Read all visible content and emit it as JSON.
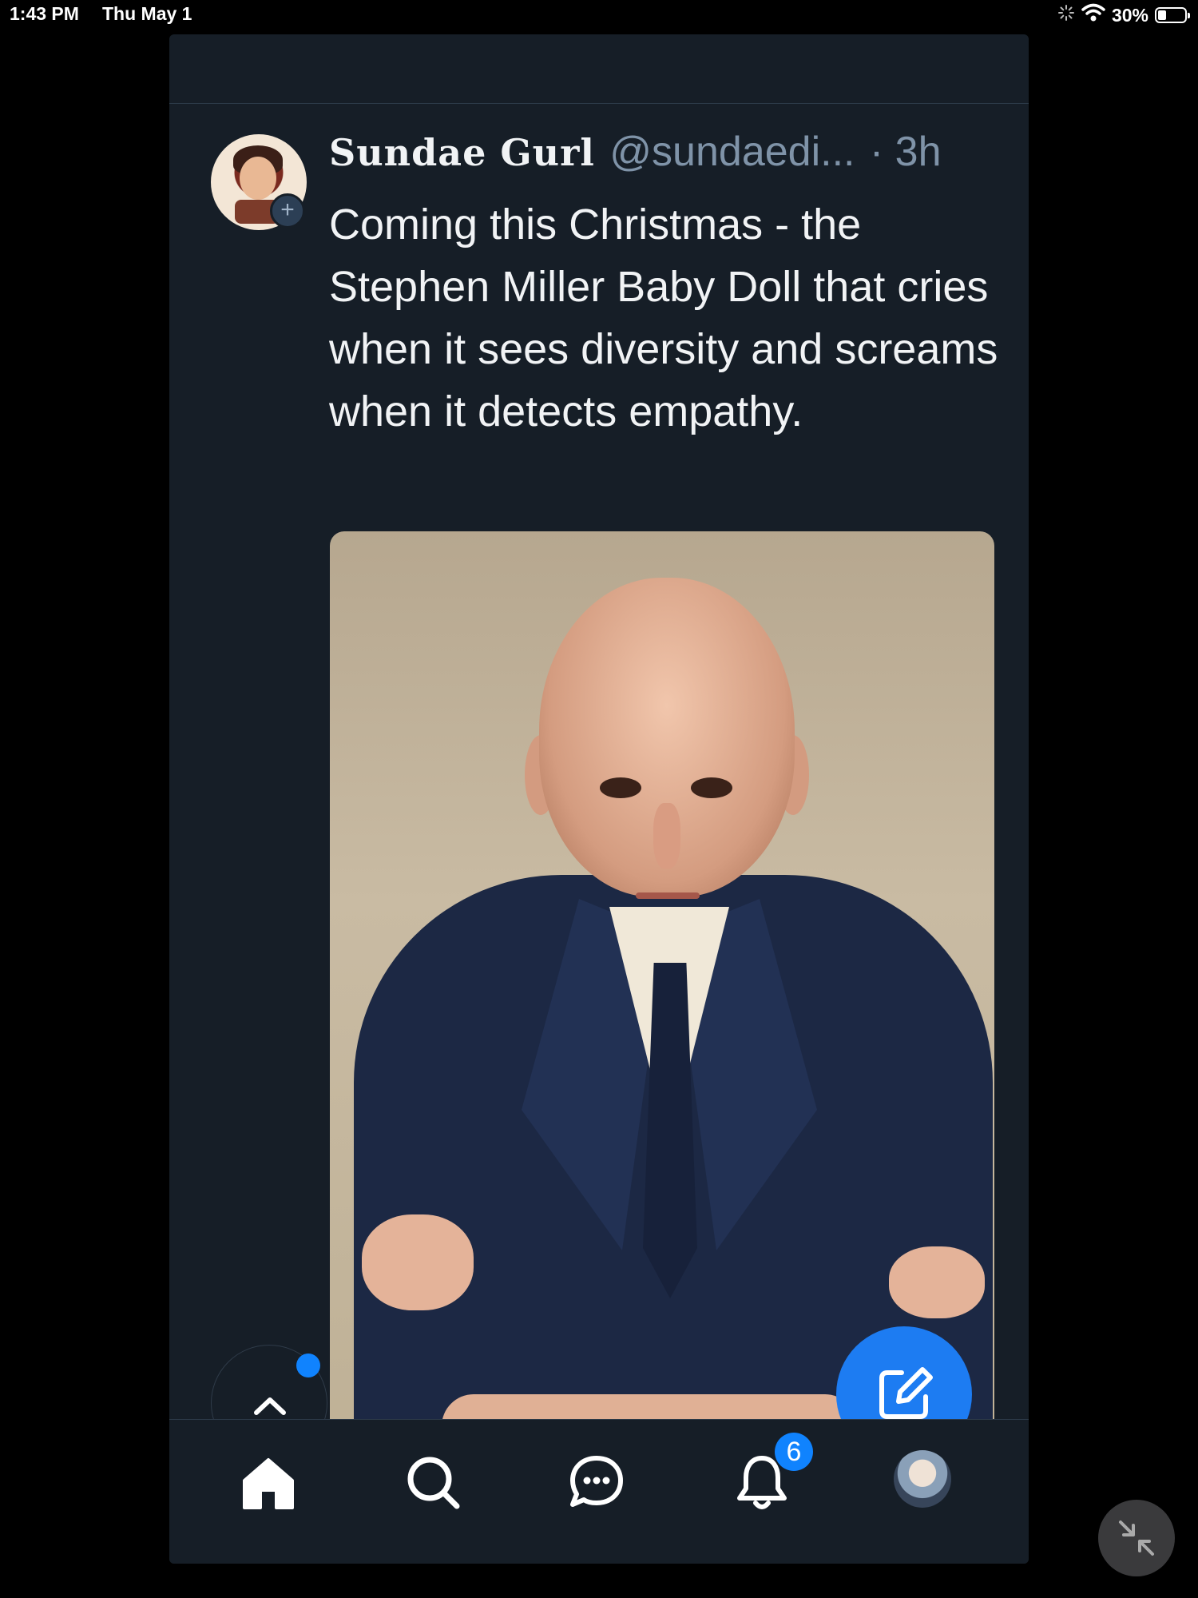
{
  "status_bar": {
    "time": "1:43 PM",
    "date": "Thu May 1",
    "battery": "30%",
    "battery_level": 0.3,
    "icons": [
      "activity-spinner-icon",
      "wifi-icon",
      "battery-icon"
    ]
  },
  "post": {
    "author_name": "Sundae Gurl",
    "handle": "@sundaedi...",
    "time": "· 3h",
    "text": "Coming this Christmas - the Stephen Miller Baby Doll that cries when it sees diversity and screams when it detects empathy.",
    "follow_icon": "plus-icon"
  },
  "floating": {
    "scroll_top_icon": "chevron-up-icon",
    "compose_icon": "compose-icon"
  },
  "nav": {
    "items": [
      {
        "name": "home",
        "icon": "home-icon"
      },
      {
        "name": "search",
        "icon": "search-icon"
      },
      {
        "name": "chat",
        "icon": "chat-icon"
      },
      {
        "name": "notifications",
        "icon": "bell-icon",
        "badge": "6"
      },
      {
        "name": "profile",
        "icon": "avatar"
      }
    ]
  },
  "colors": {
    "background": "#000000",
    "panel": "#161e27",
    "accent": "#1d7cf2",
    "badge": "#1083fe",
    "muted_text": "#7f93a8"
  }
}
